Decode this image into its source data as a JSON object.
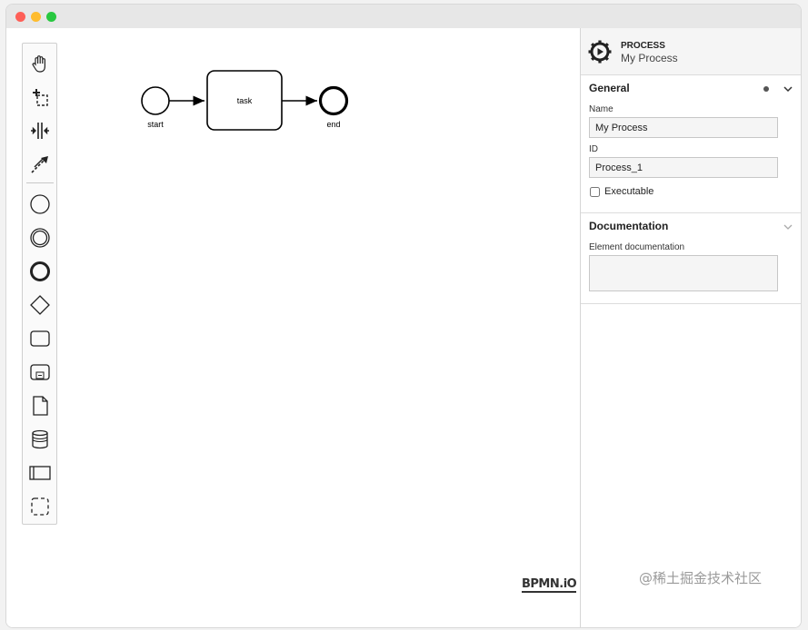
{
  "colors": {
    "window_bg": "#ffffff",
    "panel_header_bg": "#f5f5f5",
    "traffic_red": "#fe5f57",
    "traffic_yellow": "#febc2e",
    "traffic_green": "#28c840"
  },
  "palette": {
    "tools": [
      {
        "name": "hand-tool",
        "icon": "hand-icon"
      },
      {
        "name": "lasso-tool",
        "icon": "lasso-icon"
      },
      {
        "name": "space-tool",
        "icon": "space-tool-icon"
      },
      {
        "name": "global-connect-tool",
        "icon": "connect-icon"
      },
      {
        "name": "create-start-event",
        "icon": "start-event-icon"
      },
      {
        "name": "create-intermediate-event",
        "icon": "intermediate-event-icon"
      },
      {
        "name": "create-end-event",
        "icon": "end-event-icon"
      },
      {
        "name": "create-gateway",
        "icon": "gateway-icon"
      },
      {
        "name": "create-task",
        "icon": "task-icon"
      },
      {
        "name": "create-subprocess",
        "icon": "subprocess-icon"
      },
      {
        "name": "create-data-object",
        "icon": "data-object-icon"
      },
      {
        "name": "create-data-store",
        "icon": "data-store-icon"
      },
      {
        "name": "create-pool",
        "icon": "pool-icon"
      },
      {
        "name": "create-group",
        "icon": "group-icon"
      }
    ]
  },
  "diagram": {
    "start_label": "start",
    "task_label": "task",
    "end_label": "end"
  },
  "logo": "BPMN.iO",
  "watermark": "@稀土掘金技术社区",
  "properties": {
    "header": {
      "type": "PROCESS",
      "name": "My Process"
    },
    "general": {
      "title": "General",
      "name_label": "Name",
      "name_value": "My Process",
      "id_label": "ID",
      "id_value": "Process_1",
      "executable_label": "Executable"
    },
    "documentation": {
      "title": "Documentation",
      "element_doc_label": "Element documentation",
      "element_doc_value": ""
    }
  }
}
